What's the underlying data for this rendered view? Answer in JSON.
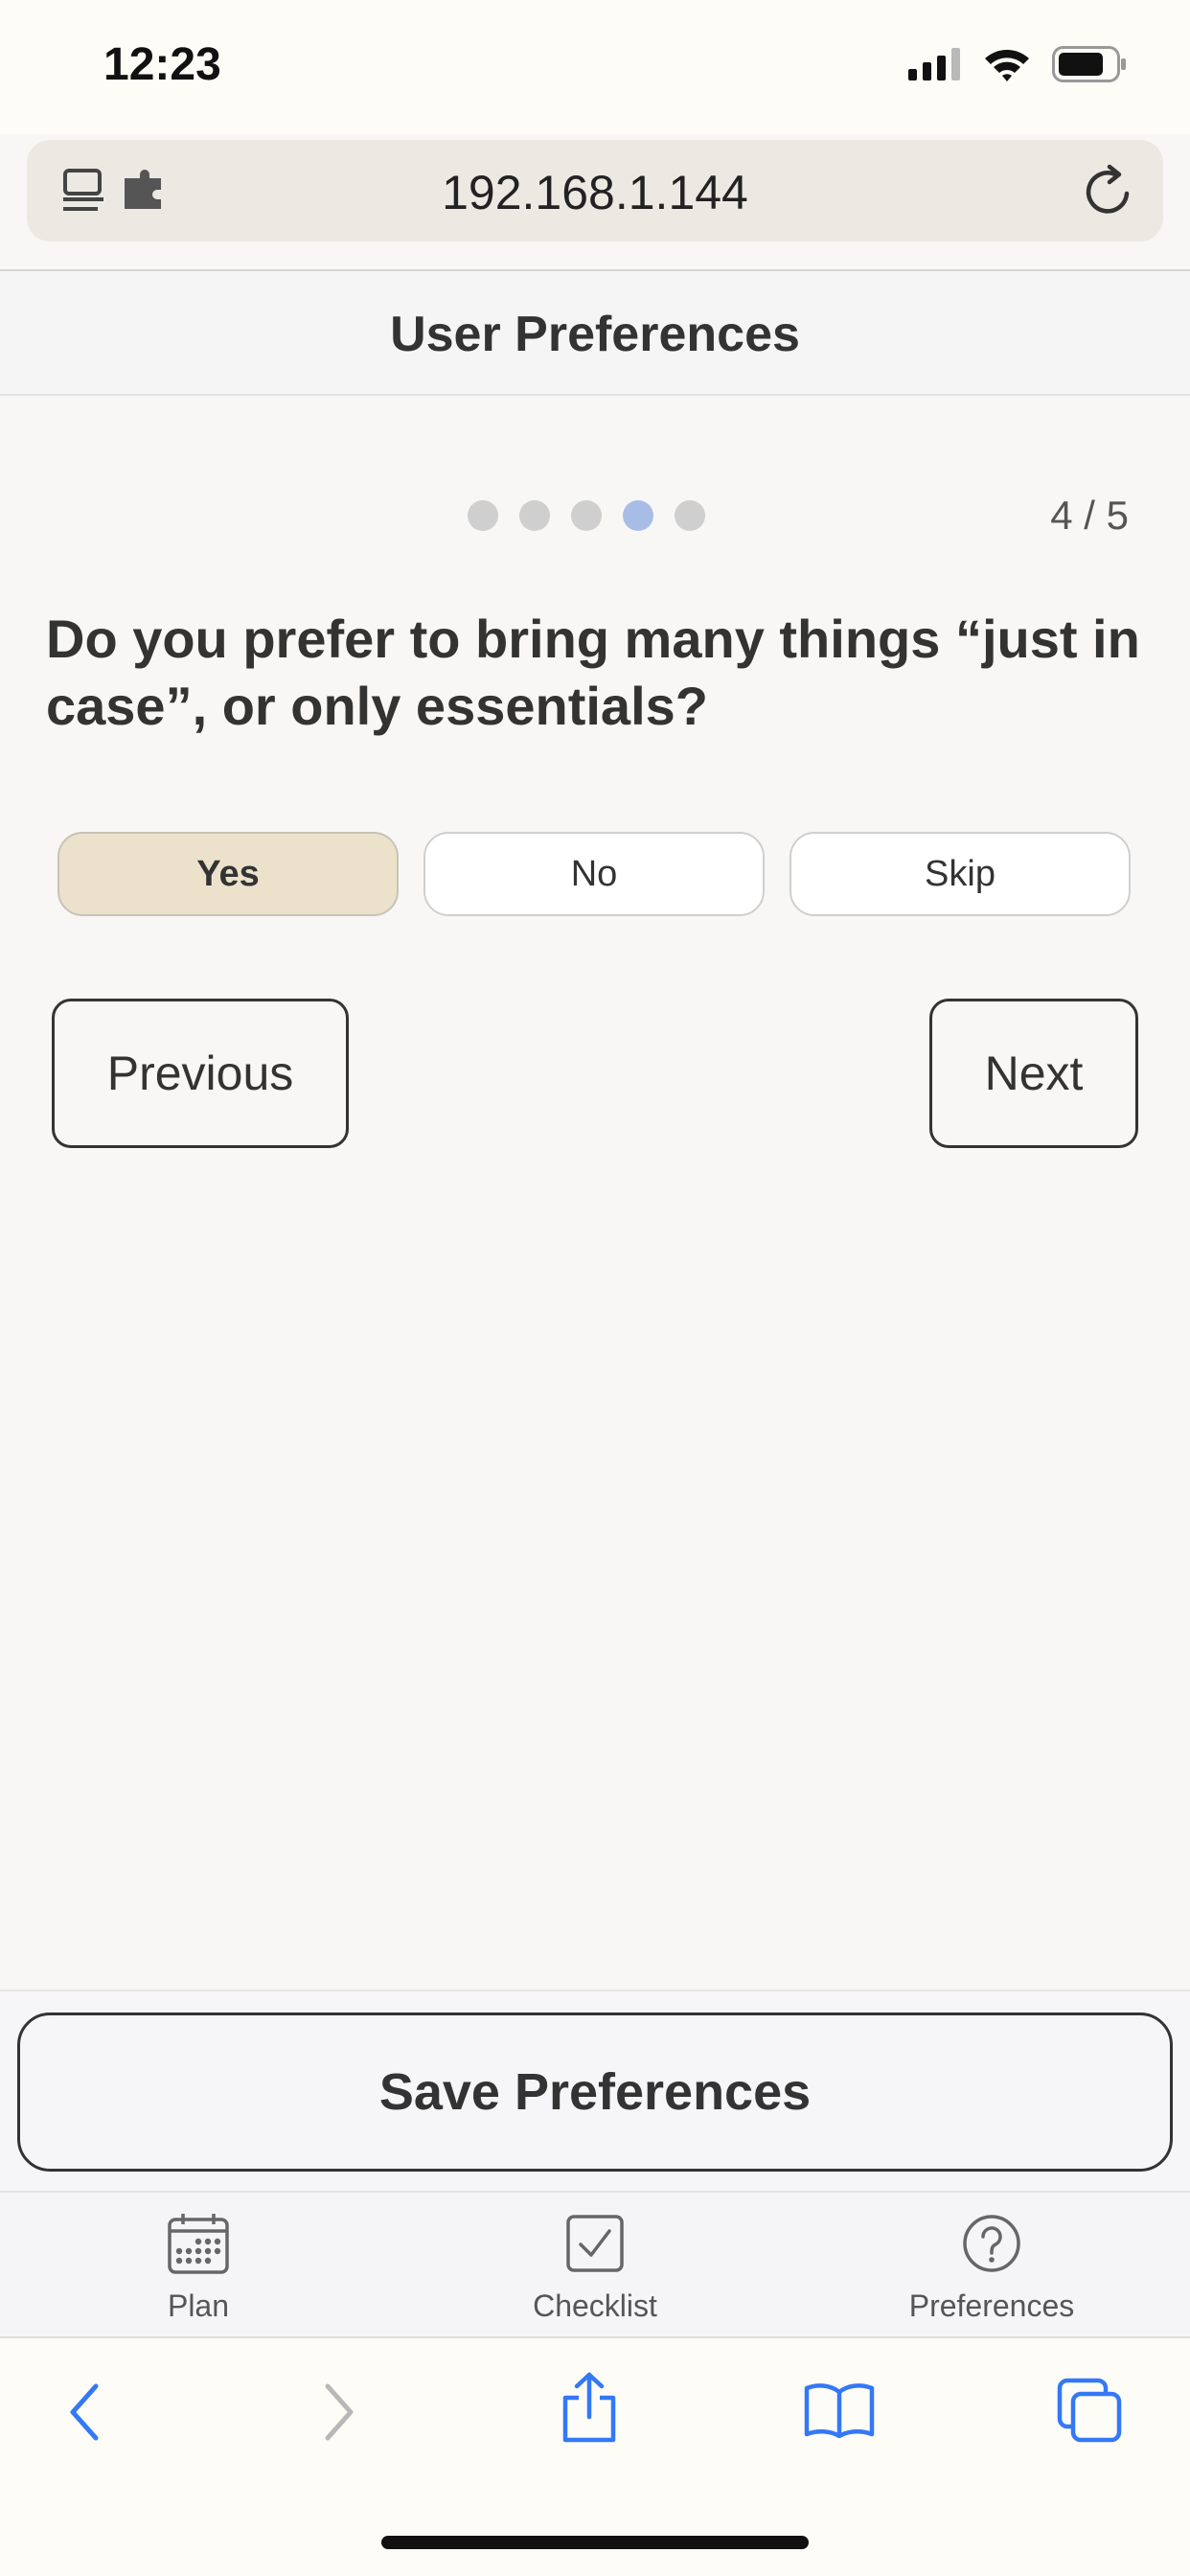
{
  "status_bar": {
    "time": "12:23",
    "icons": [
      "signal-icon",
      "wifi-icon",
      "battery-icon"
    ]
  },
  "browser": {
    "url": "192.168.1.144",
    "left_icons": [
      "reader-icon",
      "extension-icon"
    ],
    "reload_icon": "reload-icon"
  },
  "header": {
    "title": "User Preferences"
  },
  "progress": {
    "total": 5,
    "current": 4,
    "label": "4 / 5",
    "active_color": "#a8bde6",
    "inactive_color": "#cfcfcf"
  },
  "question": {
    "text": "Do you prefer to bring many things “just in case”, or only essentials?"
  },
  "options": [
    {
      "label": "Yes",
      "selected": true
    },
    {
      "label": "No",
      "selected": false
    },
    {
      "label": "Skip",
      "selected": false
    }
  ],
  "navigation": {
    "previous": "Previous",
    "next": "Next"
  },
  "save": {
    "label": "Save Preferences"
  },
  "tabs": [
    {
      "label": "Plan",
      "icon": "calendar-icon"
    },
    {
      "label": "Checklist",
      "icon": "checkbox-icon"
    },
    {
      "label": "Preferences",
      "icon": "question-circle-icon"
    }
  ],
  "toolbar": {
    "icons": [
      "back-icon",
      "forward-icon",
      "share-icon",
      "bookmarks-icon",
      "tabs-icon"
    ],
    "accent": "#3478f6"
  }
}
